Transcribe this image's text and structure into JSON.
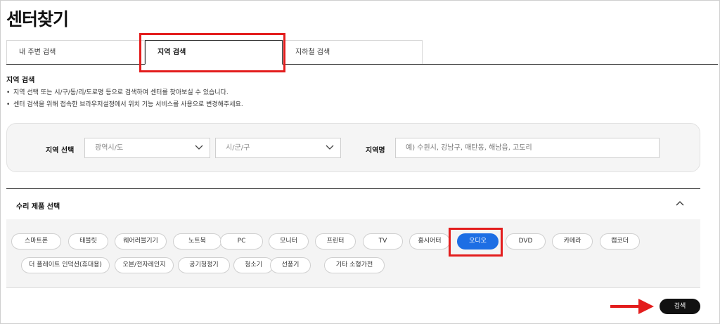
{
  "page": {
    "title": "센터찾기"
  },
  "tabs": [
    {
      "label": "내 주변 검색",
      "active": false
    },
    {
      "label": "지역 검색",
      "active": true
    },
    {
      "label": "지하철 검색",
      "active": false
    }
  ],
  "region_search": {
    "heading": "지역 검색",
    "notes": [
      "지역 선택 또는 시/구/동/리/도로명 등으로 검색하여 센터를 찾아보실 수 있습니다.",
      "센터 검색을 위해 접속한 브라우저설정에서 위치 기능 서비스를 사용으로 변경해주세요."
    ],
    "bullet": "•",
    "region_label": "지역 선택",
    "province_select": "광역시/도",
    "city_select": "시/군/구",
    "area_name_label": "지역명",
    "area_name_placeholder": "예) 수원시, 강남구, 매탄동, 해남읍, 고도리",
    "area_name_value": ""
  },
  "products": {
    "heading": "수리 제품 선택",
    "selected": "오디오",
    "row1": [
      "스마트폰",
      "태블릿",
      "웨어러블기기",
      "노트북",
      "PC",
      "모니터",
      "프린터",
      "TV",
      "홈시어터",
      "오디오",
      "DVD",
      "카메라",
      "캠코더"
    ],
    "row2": [
      "더 플레이트 인덕션(휴대용)",
      "오븐/전자레인지",
      "공기청정기",
      "청소기",
      "선풍기",
      "기타 소형가전"
    ]
  },
  "actions": {
    "search_label": "검색"
  },
  "colors": {
    "accent": "#1d6ee4",
    "annotation": "#e31d1d",
    "button": "#111111"
  },
  "icons": {
    "select_chevron": "chevron-down-icon",
    "collapse": "chevron-up-icon",
    "pointer": "arrow-right-icon"
  }
}
